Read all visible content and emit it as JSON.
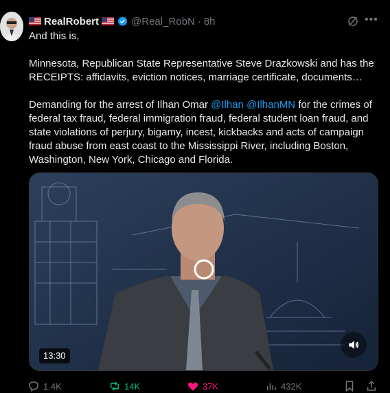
{
  "author": {
    "display_name": "RealRobert",
    "handle": "@Real_RobN",
    "separator": "·",
    "time": "8h",
    "verified": true
  },
  "tweet": {
    "line1": "And this is,",
    "para2": "Minnesota, Republican State Representative Steve Drazkowski and has the RECEIPTS: affidavits, eviction notices, marriage certificate, documents…",
    "para3_start": "Demanding for the arrest of Ilhan Omar ",
    "mention1": "@Ilhan",
    "space": " ",
    "mention2": "@IlhanMN",
    "para3_end": " for the crimes of federal tax fraud, federal immigration fraud, federal student loan fraud, and state violations of perjury, bigamy, incest, kickbacks and acts of campaign fraud abuse from east coast to the Mississippi River, including Boston, Washington, New York, Chicago and Florida."
  },
  "video": {
    "duration": "13:30"
  },
  "actions": {
    "replies": "1.4K",
    "reposts": "14K",
    "likes": "37K",
    "views": "432K"
  },
  "colors": {
    "background": "#000000",
    "text": "#e7e9ea",
    "muted": "#71767b",
    "link": "#1d9bf0",
    "repost_active": "#00ba7c",
    "like_active": "#f91880"
  },
  "icons": [
    "avatar",
    "us-flag-icon",
    "verified-icon",
    "grok-icon",
    "more-icon",
    "reply-icon",
    "retweet-icon",
    "like-icon",
    "views-icon",
    "bookmark-icon",
    "share-icon",
    "volume-icon"
  ]
}
